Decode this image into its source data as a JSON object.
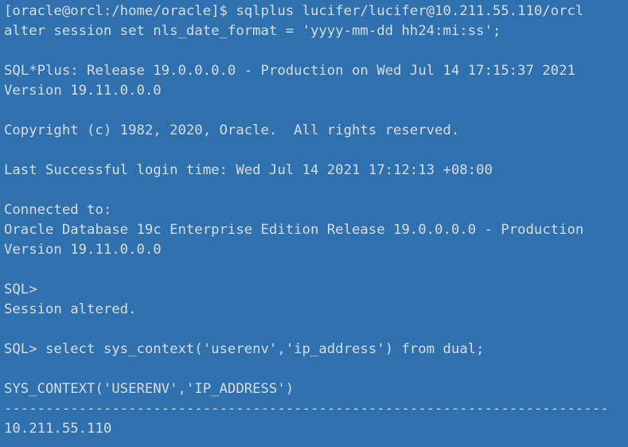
{
  "window": {
    "type": "terminal-emulator",
    "background_color": "#2f70ae",
    "foreground_color": "#d7dde0",
    "columns": 70,
    "rows": 22
  },
  "terminal": {
    "prompt_host": "[oracle@orcl:/home/oracle]$",
    "shell_command": "sqlplus lucifer/lucifer@10.211.55.110/orcl",
    "sql_prompt": "SQL>",
    "result_value": "10.211.55.110",
    "lines": [
      "[oracle@orcl:/home/oracle]$ sqlplus lucifer/lucifer@10.211.55.110/orcl",
      "alter session set nls_date_format = 'yyyy-mm-dd hh24:mi:ss';",
      "",
      "SQL*Plus: Release 19.0.0.0.0 - Production on Wed Jul 14 17:15:37 2021",
      "Version 19.11.0.0.0",
      "",
      "Copyright (c) 1982, 2020, Oracle.  All rights reserved.",
      "",
      "Last Successful login time: Wed Jul 14 2021 17:12:13 +08:00",
      "",
      "Connected to:",
      "Oracle Database 19c Enterprise Edition Release 19.0.0.0.0 - Production",
      "Version 19.11.0.0.0",
      "",
      "SQL>",
      "Session altered.",
      "",
      "SQL> select sys_context('userenv','ip_address') from dual;",
      "",
      "SYS_CONTEXT('USERENV','IP_ADDRESS')",
      "-------------------------------------------------------------------------",
      "10.211.55.110"
    ]
  }
}
